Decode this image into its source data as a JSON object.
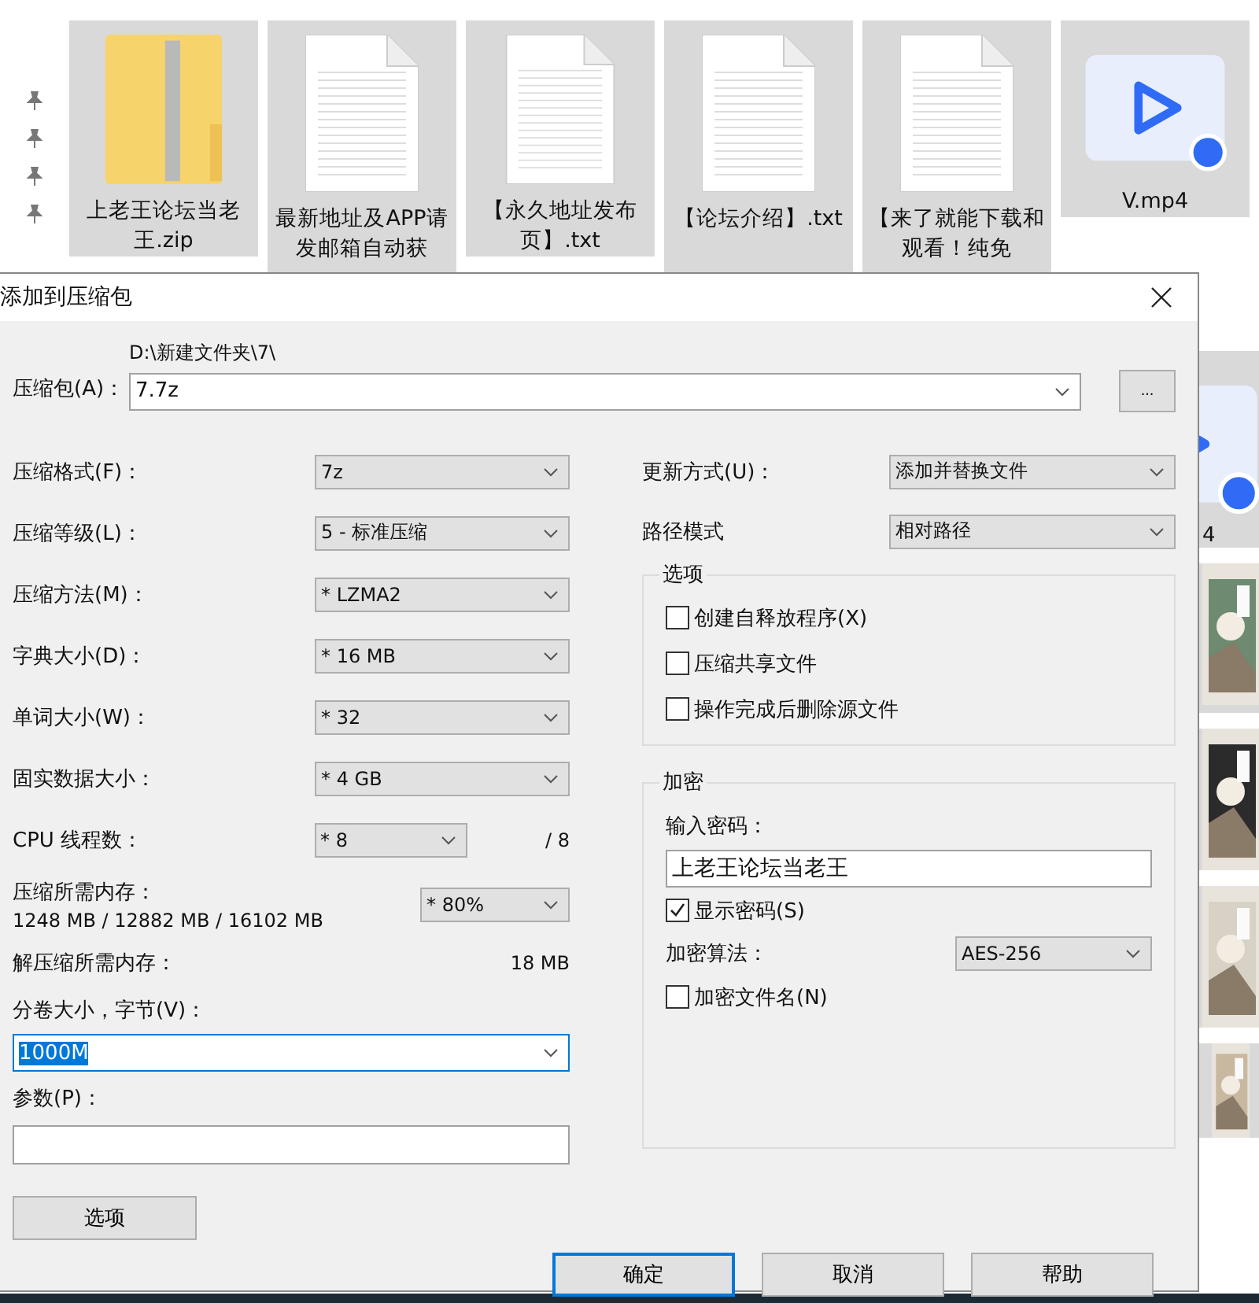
{
  "explorer": {
    "files": [
      {
        "kind": "zip",
        "name": "上老王论坛当老王.zip"
      },
      {
        "kind": "text",
        "name": "最新地址及APP请发邮箱自动获"
      },
      {
        "kind": "text",
        "name": "【永久地址发布页】.txt"
      },
      {
        "kind": "text",
        "name": "【论坛介绍】.txt"
      },
      {
        "kind": "text",
        "name": "【来了就能下载和观看！纯免"
      },
      {
        "kind": "video",
        "name": "V.mp4"
      }
    ],
    "side_items": [
      {
        "kind": "video",
        "name": "4"
      },
      {
        "kind": "picture"
      },
      {
        "kind": "picture"
      },
      {
        "kind": "picture"
      },
      {
        "kind": "picture"
      }
    ]
  },
  "dialog": {
    "title": "添加到压缩包",
    "archive": {
      "label": "压缩包(A)：",
      "folder": "D:\\新建文件夹\\7\\",
      "value": "7.7z",
      "browse": "..."
    },
    "left_fields": [
      {
        "label": "压缩格式(F)：",
        "value": "7z"
      },
      {
        "label": "压缩等级(L)：",
        "value": "5 - 标准压缩"
      },
      {
        "label": "压缩方法(M)：",
        "value": "* LZMA2"
      },
      {
        "label": "字典大小(D)：",
        "value": "* 16 MB"
      },
      {
        "label": "单词大小(W)：",
        "value": "* 32"
      },
      {
        "label": "固实数据大小：",
        "value": "* 4 GB"
      }
    ],
    "cpu_threads": {
      "label": "CPU 线程数：",
      "value": "* 8",
      "max": "/ 8"
    },
    "compress_memory": {
      "label": "压缩所需内存：",
      "usage": "1248 MB / 12882 MB / 16102 MB",
      "value": "* 80%"
    },
    "decompress_memory": {
      "label": "解压缩所需内存：",
      "value": "18 MB"
    },
    "volume": {
      "label": "分卷大小，字节(V)：",
      "value": "1000M"
    },
    "parameters": {
      "label": "参数(P)："
    },
    "options_button": "选项",
    "update_mode": {
      "label": "更新方式(U)：",
      "value": "添加并替换文件"
    },
    "path_mode": {
      "label": "路径模式",
      "value": "相对路径"
    },
    "options_group": {
      "title": "选项",
      "checkboxes": [
        {
          "label": "创建自释放程序(X)",
          "checked": false
        },
        {
          "label": "压缩共享文件",
          "checked": false
        },
        {
          "label": "操作完成后删除源文件",
          "checked": false
        }
      ]
    },
    "encryption": {
      "title": "加密",
      "password_label": "输入密码：",
      "password": "上老王论坛当老王",
      "show_password": {
        "label": "显示密码(S)",
        "checked": true
      },
      "method": {
        "label": "加密算法：",
        "value": "AES-256"
      },
      "encrypt_names": {
        "label": "加密文件名(N)",
        "checked": false
      }
    },
    "buttons": [
      {
        "label": "确定",
        "focused": true
      },
      {
        "label": "取消",
        "focused": false
      },
      {
        "label": "帮助",
        "focused": false
      }
    ]
  }
}
